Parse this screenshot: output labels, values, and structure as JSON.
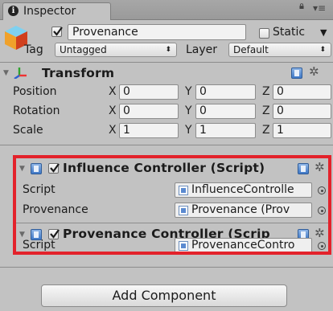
{
  "window": {
    "tab_label": "Inspector"
  },
  "object": {
    "name": "Provenance",
    "active": true,
    "static_label": "Static",
    "static_checked": false,
    "tag_label": "Tag",
    "tag_value": "Untagged",
    "layer_label": "Layer",
    "layer_value": "Default"
  },
  "transform": {
    "title": "Transform",
    "rows": [
      {
        "label": "Position",
        "x": "0",
        "y": "0",
        "z": "0"
      },
      {
        "label": "Rotation",
        "x": "0",
        "y": "0",
        "z": "0"
      },
      {
        "label": "Scale",
        "x": "1",
        "y": "1",
        "z": "1"
      }
    ],
    "axis_x": "X",
    "axis_y": "Y",
    "axis_z": "Z"
  },
  "influence": {
    "title": "Influence Controller (Script)",
    "enabled": true,
    "script_label": "Script",
    "script_value": "InfluenceControlle",
    "prov_label": "Provenance",
    "prov_value": "Provenance (Prov"
  },
  "provenance": {
    "title": "Provenance Controller (Scrip",
    "enabled": true,
    "script_label": "Script",
    "script_value": "ProvenanceContro"
  },
  "add_component_label": "Add Component",
  "colors": {
    "highlight": "#e3222b",
    "panel": "#c2c2c2",
    "script_icon": "#3f78c6"
  },
  "icons": [
    "info-icon",
    "lock-icon",
    "menu-icon",
    "gameobject-cube-icon",
    "transform-axes-icon",
    "script-icon",
    "help-book-icon",
    "gear-icon",
    "object-picker-icon"
  ]
}
